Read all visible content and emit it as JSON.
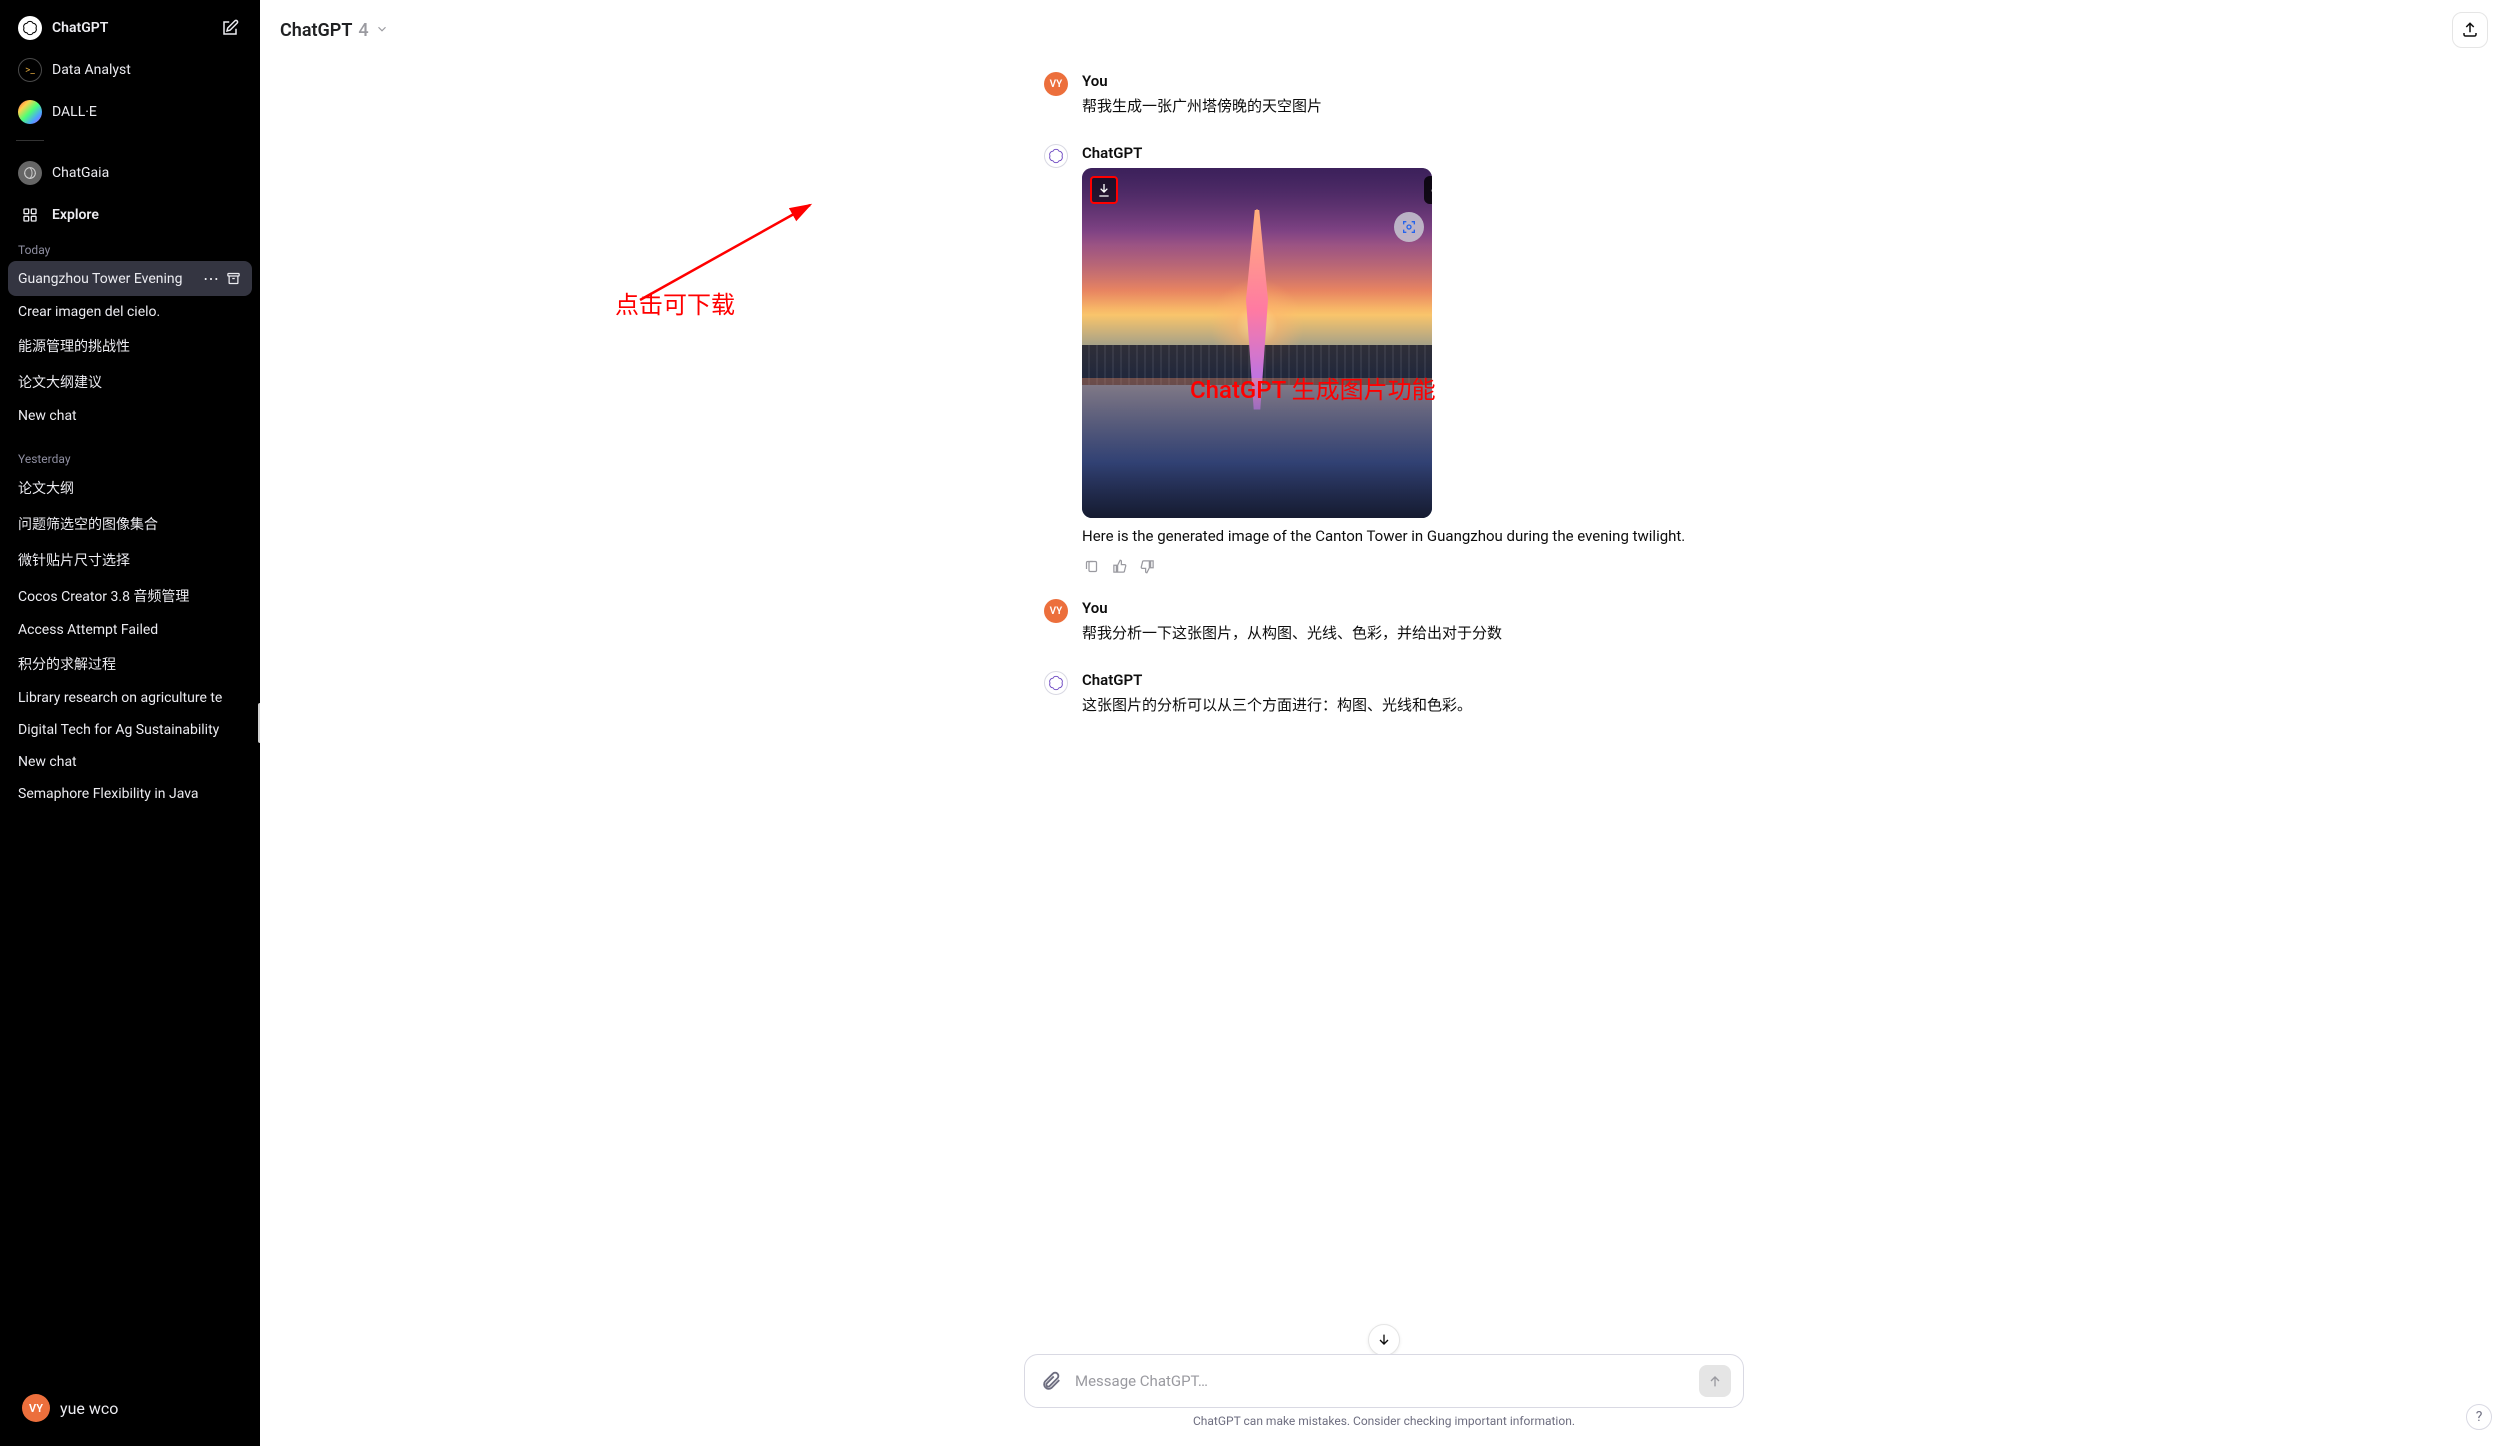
{
  "sidebar": {
    "chatgpt_label": "ChatGPT",
    "data_analyst_label": "Data Analyst",
    "dalle_label": "DALL·E",
    "chatgaia_label": "ChatGaia",
    "explore_label": "Explore",
    "today_label": "Today",
    "yesterday_label": "Yesterday",
    "today_chats": [
      "Guangzhou Tower Evening",
      "Crear imagen del cielo.",
      "能源管理的挑战性",
      "论文大纲建议",
      "New chat"
    ],
    "yesterday_chats": [
      "论文大纲",
      "问题筛选空的图像集合",
      "微针贴片尺寸选择",
      "Cocos Creator 3.8 音频管理",
      "Access Attempt Failed",
      "积分的求解过程",
      "Library research on agriculture te",
      "Digital Tech for Ag Sustainability",
      "New chat",
      "Semaphore Flexibility in Java"
    ],
    "user_name": "yue wco",
    "user_initials": "VY"
  },
  "header": {
    "model": "ChatGPT",
    "version": "4"
  },
  "conversation": {
    "you_label": "You",
    "bot_label": "ChatGPT",
    "user_initials": "VY",
    "msg1_text": "帮我生成一张广州塔傍晚的天空图片",
    "msg2_caption": "Here is the generated image of the Canton Tower in Guangzhou during the evening twilight.",
    "msg3_text": "帮我分析一下这张图片，从构图、光线、色彩，并给出对于分数",
    "msg4_text": "这张图片的分析可以从三个方面进行：构图、光线和色彩。"
  },
  "composer": {
    "placeholder": "Message ChatGPT…"
  },
  "disclaimer": "ChatGPT can make mistakes. Consider checking important information.",
  "annotations": {
    "download_hint": "点击可下载",
    "feature_label": "ChatGPT 生成图片功能"
  },
  "colors": {
    "annotation_red": "#ff0000",
    "user_avatar_bg": "#ec6f3c"
  }
}
